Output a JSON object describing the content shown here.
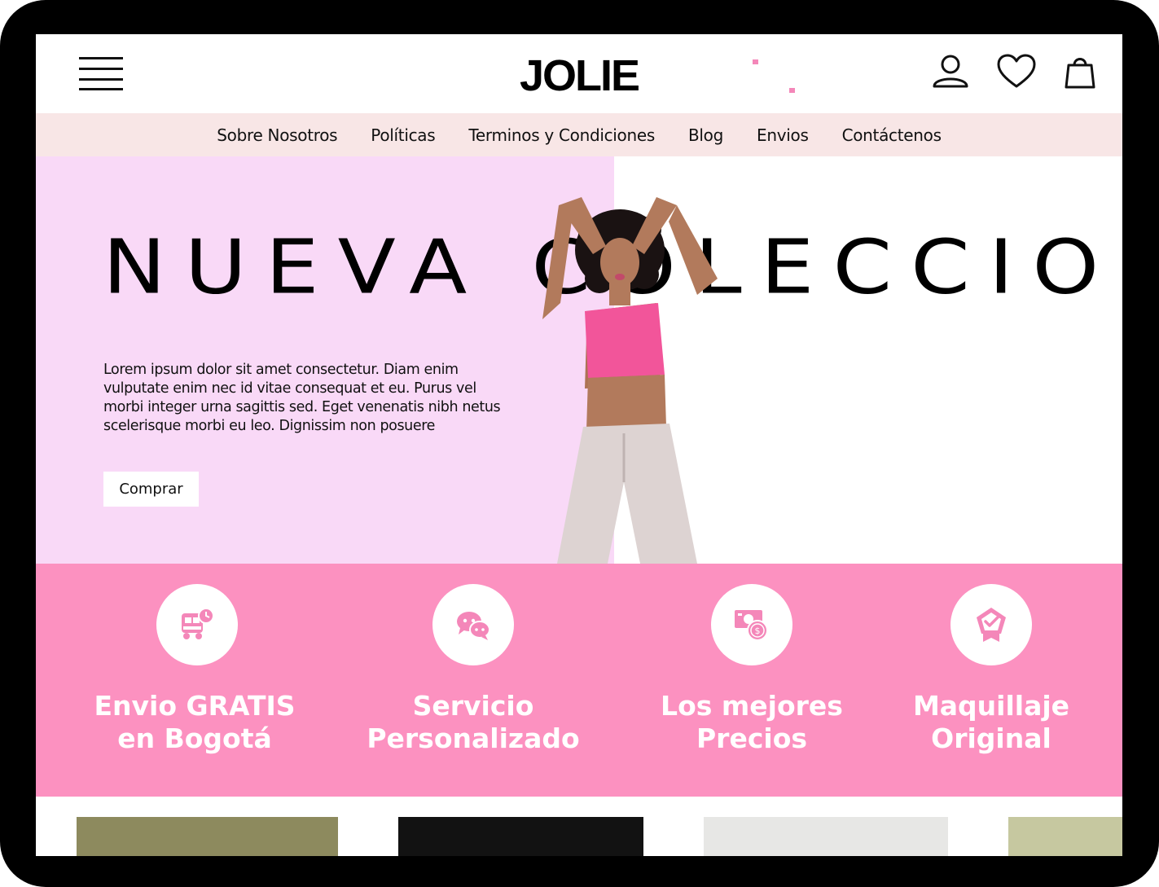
{
  "header": {
    "logo": "JOLIE",
    "icons": [
      "menu-icon",
      "user-icon",
      "heart-icon",
      "bag-icon"
    ]
  },
  "nav": {
    "items": [
      {
        "label": "Sobre Nosotros"
      },
      {
        "label": "Políticas"
      },
      {
        "label": "Terminos y Condiciones"
      },
      {
        "label": "Blog"
      },
      {
        "label": "Envios"
      },
      {
        "label": "Contáctenos"
      }
    ]
  },
  "hero": {
    "title": "NUEVA COLECCION",
    "description": "Lorem ipsum dolor sit amet consectetur. Diam enim vulputate enim nec id vitae consequat et eu. Purus vel morbi integer urna sagittis sed. Eget venenatis nibh netus scelerisque morbi eu leo. Dignissim non posuere",
    "button": "Comprar"
  },
  "features": [
    {
      "line1": "Envio GRATIS",
      "line2": "en Bogotá",
      "icon": "delivery-truck-clock-icon"
    },
    {
      "line1": "Servicio",
      "line2": "Personalizado",
      "icon": "chat-bubbles-icon"
    },
    {
      "line1": "Los mejores",
      "line2": "Precios",
      "icon": "money-coin-icon"
    },
    {
      "line1": "Maquillaje",
      "line2": "Original",
      "icon": "quality-badge-icon"
    }
  ],
  "colors": {
    "hero_pink": "#f9d9f7",
    "feature_pink": "#fc91c0",
    "nav_bg": "#f8e6e6",
    "accent": "#f487b9"
  }
}
